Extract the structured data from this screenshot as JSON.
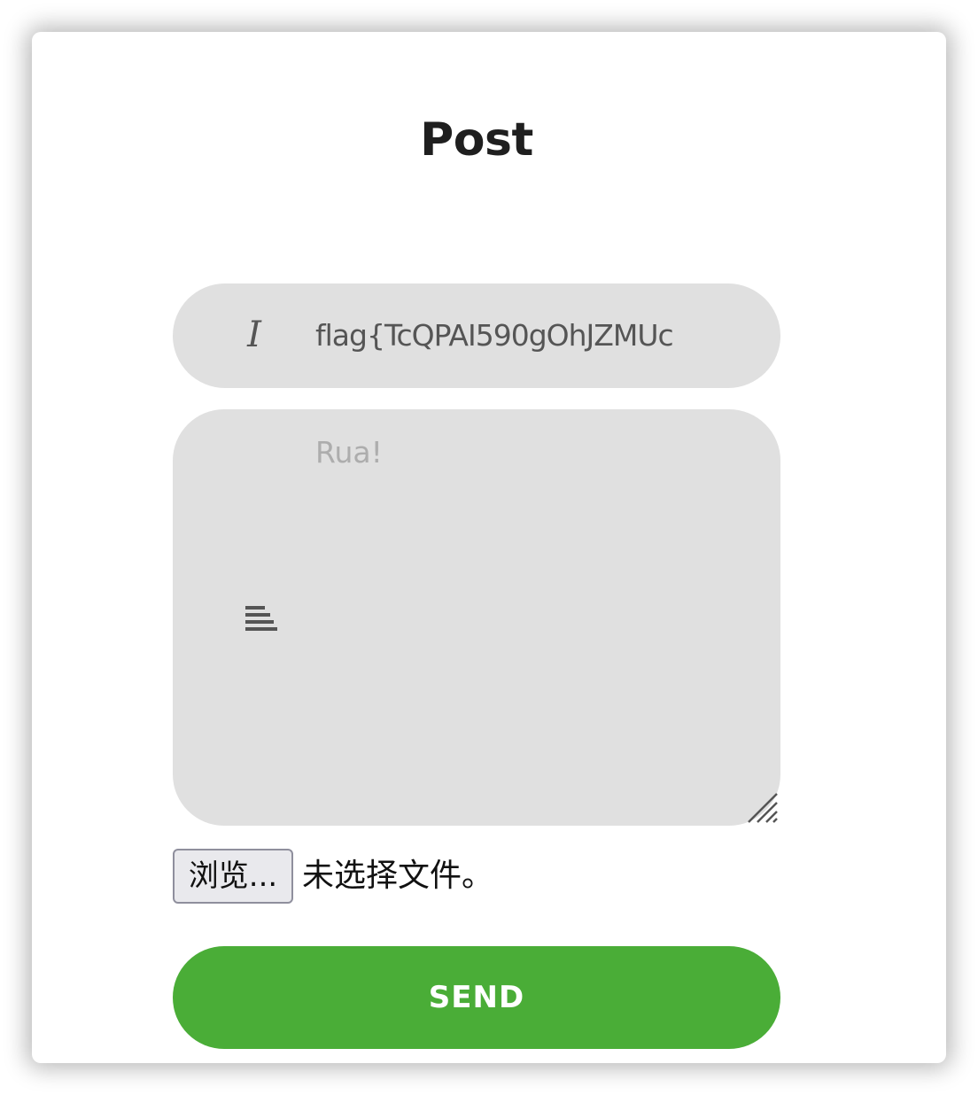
{
  "form": {
    "title": "Post",
    "title_input": {
      "value": "flag{TcQPAI590gOhJZMUc",
      "icon": "italic-i-icon"
    },
    "body_textarea": {
      "placeholder": "Rua!",
      "value": "",
      "icon": "align-left-lines-icon"
    },
    "file_input": {
      "button_label": "浏览...",
      "status": "未选择文件。"
    },
    "send_button_label": "SEND"
  },
  "colors": {
    "field_background": "#e0e0e0",
    "send_button": "#4aad37",
    "icon": "#555555",
    "placeholder": "#adadad"
  }
}
